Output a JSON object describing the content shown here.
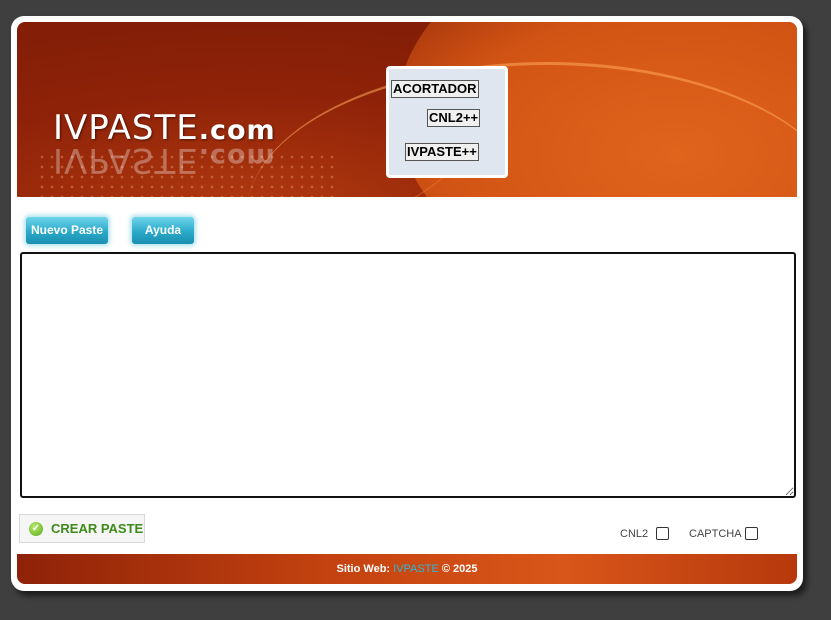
{
  "header": {
    "logo_main": "IVPASTE",
    "logo_domain": ".com",
    "menu": [
      {
        "label": "ACORTADOR"
      },
      {
        "label": "CNL2++"
      },
      {
        "label": "IVPASTE++"
      }
    ]
  },
  "tabs": {
    "new_paste": "Nuevo Paste",
    "help": "Ayuda"
  },
  "editor": {
    "value": ""
  },
  "actions": {
    "create_paste": "CREAR PASTE"
  },
  "options": {
    "cnl2_label": "CNL2",
    "cnl2_checked": false,
    "captcha_label": "CAPTCHA",
    "captcha_checked": false
  },
  "footer": {
    "prefix": "Sitio Web:",
    "link_text": "IVPASTE",
    "suffix": "© 2025"
  },
  "colors": {
    "page_background": "#3f3f3f",
    "tab_button": "#2aa9c9",
    "create_text": "#3e8a1a",
    "footer_link": "#2fb6d9"
  }
}
